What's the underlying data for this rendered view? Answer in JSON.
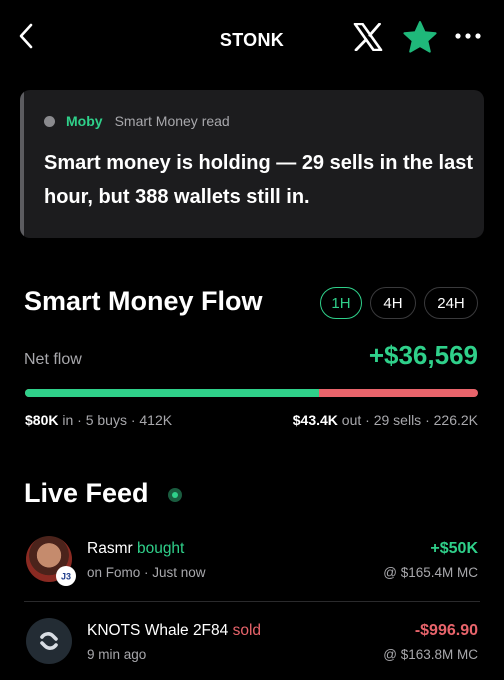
{
  "header": {
    "title": "STONK",
    "icons": [
      "back-chevron-icon",
      "x-logo-icon",
      "star-icon",
      "more-dots-icon"
    ]
  },
  "insight": {
    "author": "Moby",
    "subtitle": "Smart Money read",
    "text": "Smart money is holding — 29 sells in the last hour, but 388 wallets still in."
  },
  "flow": {
    "title": "Smart Money Flow",
    "timeframes": [
      "1H",
      "4H",
      "24H"
    ],
    "active_timeframe": "1H",
    "net_label": "Net flow",
    "net_value": "+$36,569",
    "in_share": 0.65,
    "in_amount": "$80K",
    "in_detail": " in · 5 buys · 412K",
    "out_amount": "$43.4K",
    "out_detail": " out · 29 sells · 226.2K"
  },
  "feed": {
    "title": "Live Feed",
    "items": [
      {
        "name": "Rasmr",
        "action": "bought",
        "meta": "on Fomo · Just now",
        "amount": "+$50K",
        "market_cap": "@ $165.4M MC",
        "badge": "J3"
      },
      {
        "name": "KNOTS Whale 2F84",
        "action": "sold",
        "meta": "9 min ago",
        "amount": "-$996.90",
        "market_cap": "@ $163.8M MC"
      }
    ]
  },
  "colors": {
    "accent_green": "#2fd08a",
    "accent_red": "#e8646b",
    "star": "#1fb87a",
    "background": "#000000",
    "card": "#1c1c1e"
  }
}
